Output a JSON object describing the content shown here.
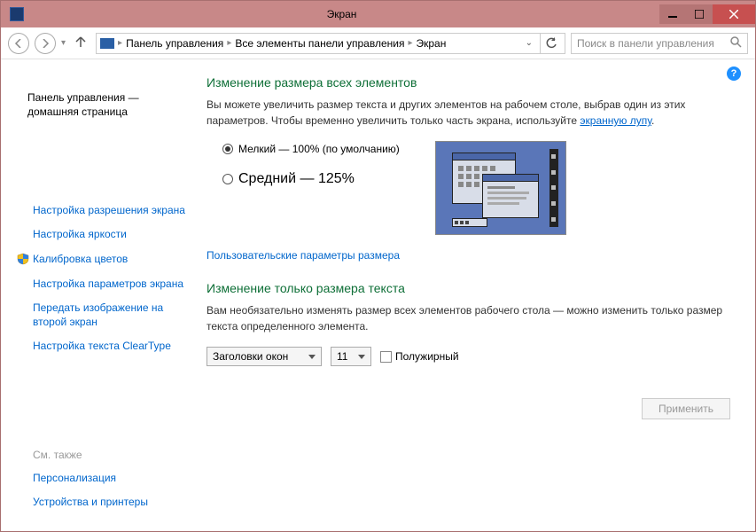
{
  "window": {
    "title": "Экран"
  },
  "nav": {
    "breadcrumb": [
      "Панель управления",
      "Все элементы панели управления",
      "Экран"
    ],
    "search_placeholder": "Поиск в панели управления"
  },
  "sidebar": {
    "home": "Панель управления — домашняя страница",
    "links": [
      "Настройка разрешения экрана",
      "Настройка яркости",
      "Калибровка цветов",
      "Настройка параметров экрана",
      "Передать изображение на второй экран",
      "Настройка текста ClearType"
    ],
    "see_also_heading": "См. также",
    "see_also": [
      "Персонализация",
      "Устройства и принтеры"
    ]
  },
  "main": {
    "h1": "Изменение размера всех элементов",
    "desc_prefix": "Вы можете увеличить размер текста и других элементов на рабочем столе, выбрав один из этих параметров. Чтобы временно увеличить только часть экрана, используйте ",
    "desc_link": "экранную лупу",
    "desc_suffix": ".",
    "radio1": "Мелкий — 100% (по умолчанию)",
    "radio2": "Средний — 125%",
    "custom_link": "Пользовательские параметры размера",
    "h2": "Изменение только размера текста",
    "desc2": "Вам необязательно изменять размер всех элементов рабочего стола — можно изменить только размер текста определенного элемента.",
    "select_element": "Заголовки окон",
    "select_size": "11",
    "checkbox_bold": "Полужирный",
    "apply": "Применить"
  }
}
